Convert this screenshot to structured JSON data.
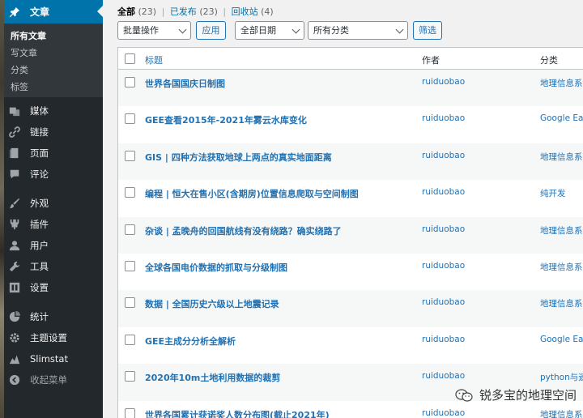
{
  "sidebar": {
    "active": {
      "label": "文章",
      "icon": "pin-icon"
    },
    "submenu": [
      "所有文章",
      "写文章",
      "分类",
      "标签"
    ],
    "items": [
      {
        "label": "媒体",
        "icon": "media-icon"
      },
      {
        "label": "链接",
        "icon": "link-icon"
      },
      {
        "label": "页面",
        "icon": "page-icon"
      },
      {
        "label": "评论",
        "icon": "comment-icon"
      },
      {
        "label": "外观",
        "icon": "brush-icon"
      },
      {
        "label": "插件",
        "icon": "plugin-icon"
      },
      {
        "label": "用户",
        "icon": "user-icon"
      },
      {
        "label": "工具",
        "icon": "wrench-icon"
      },
      {
        "label": "设置",
        "icon": "settings-icon"
      },
      {
        "label": "统计",
        "icon": "chart-pie-icon"
      },
      {
        "label": "主题设置",
        "icon": "gear-icon"
      },
      {
        "label": "Slimstat",
        "icon": "slimstat-icon"
      },
      {
        "label": "收起菜单",
        "icon": "collapse-icon"
      }
    ]
  },
  "filters": {
    "all": "全部",
    "all_count": "(23)",
    "published": "已发布",
    "published_count": "(23)",
    "trash": "回收站",
    "trash_count": "(4)"
  },
  "toolbar": {
    "bulk_actions": "批量操作",
    "apply": "应用",
    "all_dates": "全部日期",
    "all_categories": "所有分类",
    "filter": "筛选"
  },
  "table": {
    "headers": {
      "title": "标题",
      "author": "作者",
      "category": "分类"
    },
    "rows": [
      {
        "title": "世界各国国庆日制图",
        "author": "ruiduobao",
        "category": "地理信息系统"
      },
      {
        "title": "GEE查看2015年-2021年雾云水库变化",
        "author": "ruiduobao",
        "category": "Google Earth"
      },
      {
        "title": "GIS | 四种方法获取地球上两点的真实地面距离",
        "author": "ruiduobao",
        "category": "地理信息系统"
      },
      {
        "title": "编程 | 恒大在售小区(含期房)位置信息爬取与空间制图",
        "author": "ruiduobao",
        "category": "纯开发"
      },
      {
        "title": "杂谈 | 孟晚舟的回国航线有没有绕路？确实绕路了",
        "author": "ruiduobao",
        "category": "地理信息系统"
      },
      {
        "title": "全球各国电价数据的抓取与分级制图",
        "author": "ruiduobao",
        "category": "地理信息系统"
      },
      {
        "title": "数据 | 全国历史六级以上地震记录",
        "author": "ruiduobao",
        "category": "地理信息系统"
      },
      {
        "title": "GEE主成分分析全解析",
        "author": "ruiduobao",
        "category": "Google Earth"
      },
      {
        "title": "2020年10m土地利用数据的裁剪",
        "author": "ruiduobao",
        "category": "python与遥感"
      },
      {
        "title": "世界各国累计获诺奖人数分布图(截止2021年)",
        "author": "ruiduobao",
        "category": "地理信息系统"
      }
    ]
  },
  "watermark": {
    "text": "锐多宝的地理空间",
    "icon": "wechat-icon"
  }
}
